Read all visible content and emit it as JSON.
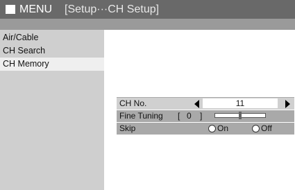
{
  "header": {
    "menu_label": "MENU",
    "breadcrumb": "[Setup···CH Setup]"
  },
  "sidebar": {
    "items": [
      {
        "label": "Air/Cable",
        "selected": false
      },
      {
        "label": "CH Search",
        "selected": false
      },
      {
        "label": "CH Memory",
        "selected": true
      }
    ]
  },
  "settings": {
    "ch_no": {
      "label": "CH No.",
      "value": "11",
      "left_arrow": "triangle-left-icon",
      "right_arrow": "triangle-right-icon"
    },
    "fine_tuning": {
      "label": "Fine Tuning",
      "bracket_open": "[",
      "value": "0",
      "bracket_close": "]",
      "level_fraction": 0.5
    },
    "skip": {
      "label": "Skip",
      "options": [
        {
          "label": "On",
          "selected": false
        },
        {
          "label": "Off",
          "selected": false
        }
      ]
    }
  },
  "colors": {
    "titlebar": "#696969",
    "subbar": "#9a9a9a",
    "sidebar": "#cfcfcf",
    "selected_item": "#efefef",
    "panel": "#a9a9a9",
    "highlight_row": "#d0d0d0"
  }
}
